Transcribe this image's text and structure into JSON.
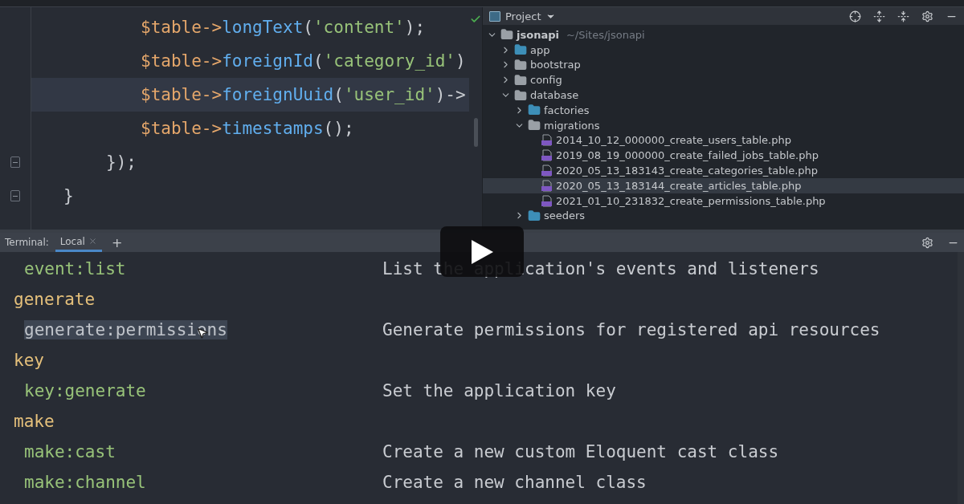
{
  "editor": {
    "lines": [
      {
        "kind": "statement",
        "current": false,
        "tokens": [
          {
            "kind": "var",
            "text": "$table"
          },
          {
            "kind": "op",
            "text": "->"
          },
          {
            "kind": "method",
            "text": "longText"
          },
          {
            "kind": "punct",
            "text": "("
          },
          {
            "kind": "string",
            "text": "'content'"
          },
          {
            "kind": "punct",
            "text": ");"
          }
        ]
      },
      {
        "kind": "statement",
        "current": false,
        "tokens": [
          {
            "kind": "var",
            "text": "$table"
          },
          {
            "kind": "op",
            "text": "->"
          },
          {
            "kind": "method",
            "text": "foreignId"
          },
          {
            "kind": "punct",
            "text": "("
          },
          {
            "kind": "string",
            "text": "'category_id'"
          },
          {
            "kind": "punct",
            "text": ")"
          }
        ]
      },
      {
        "kind": "statement",
        "current": true,
        "tokens": [
          {
            "kind": "var",
            "text": "$table"
          },
          {
            "kind": "op",
            "text": "->"
          },
          {
            "kind": "method",
            "text": "foreignUuid"
          },
          {
            "kind": "punct",
            "text": "("
          },
          {
            "kind": "string",
            "text": "'user_id'"
          },
          {
            "kind": "punct",
            "text": ")->"
          }
        ]
      },
      {
        "kind": "statement",
        "current": false,
        "tokens": [
          {
            "kind": "var",
            "text": "$table"
          },
          {
            "kind": "op",
            "text": "->"
          },
          {
            "kind": "method",
            "text": "timestamps"
          },
          {
            "kind": "punct",
            "text": "();"
          }
        ]
      },
      {
        "kind": "closure-end",
        "current": false,
        "tokens": [
          {
            "kind": "punct",
            "text": "});"
          }
        ]
      },
      {
        "kind": "block-end",
        "current": false,
        "tokens": [
          {
            "kind": "punct",
            "text": "}"
          }
        ]
      }
    ]
  },
  "project": {
    "title": "Project",
    "tree": [
      {
        "label": "jsonapi",
        "path": "~/Sites/jsonapi",
        "kind": "root",
        "expanded": true,
        "selected": false,
        "children": [
          {
            "label": "app",
            "kind": "folder",
            "color": "#3d8fb8",
            "expanded": false,
            "selected": false
          },
          {
            "label": "bootstrap",
            "kind": "folder",
            "color": "#9aa0a6",
            "expanded": false,
            "selected": false
          },
          {
            "label": "config",
            "kind": "folder",
            "color": "#9aa0a6",
            "expanded": false,
            "selected": false
          },
          {
            "label": "database",
            "kind": "folder",
            "color": "#9aa0a6",
            "expanded": true,
            "selected": false,
            "children": [
              {
                "label": "factories",
                "kind": "folder",
                "color": "#3d8fb8",
                "expanded": false,
                "selected": false
              },
              {
                "label": "migrations",
                "kind": "folder",
                "color": "#9aa0a6",
                "expanded": true,
                "selected": false,
                "children": [
                  {
                    "label": "2014_10_12_000000_create_users_table.php",
                    "kind": "php",
                    "selected": false
                  },
                  {
                    "label": "2019_08_19_000000_create_failed_jobs_table.php",
                    "kind": "php",
                    "selected": false
                  },
                  {
                    "label": "2020_05_13_183143_create_categories_table.php",
                    "kind": "php",
                    "selected": false
                  },
                  {
                    "label": "2020_05_13_183144_create_articles_table.php",
                    "kind": "php",
                    "selected": true
                  },
                  {
                    "label": "2021_01_10_231832_create_permissions_table.php",
                    "kind": "php",
                    "selected": false
                  }
                ]
              },
              {
                "label": "seeders",
                "kind": "folder",
                "color": "#3d8fb8",
                "expanded": false,
                "selected": false
              }
            ]
          }
        ]
      }
    ]
  },
  "terminal": {
    "label": "Terminal:",
    "tabs": [
      {
        "label": "Local",
        "selected": true
      }
    ],
    "add": "+",
    "lines": [
      {
        "kind": "command",
        "command": "event:list",
        "description": "List the application's events and listeners",
        "selected": false
      },
      {
        "kind": "group",
        "command": "generate"
      },
      {
        "kind": "command",
        "command": "generate:permissions",
        "description": "Generate permissions for registered api resources",
        "selected": true
      },
      {
        "kind": "group",
        "command": "key"
      },
      {
        "kind": "command",
        "command": "key:generate",
        "description": "Set the application key",
        "selected": false
      },
      {
        "kind": "group",
        "command": "make"
      },
      {
        "kind": "command",
        "command": "make:cast",
        "description": "Create a new custom Eloquent cast class",
        "selected": false
      },
      {
        "kind": "command",
        "command": "make:channel",
        "description": "Create a new channel class",
        "selected": false
      }
    ]
  }
}
